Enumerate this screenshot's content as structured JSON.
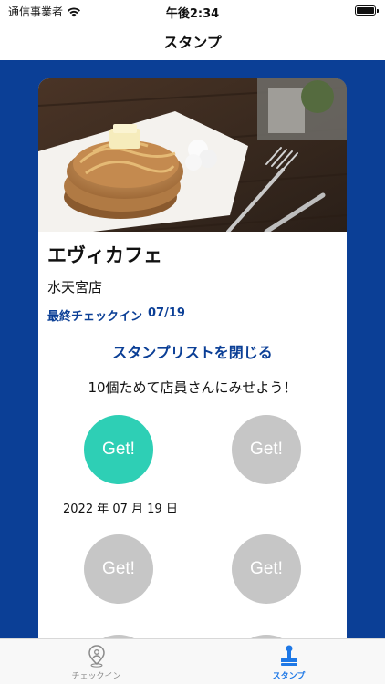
{
  "status_bar": {
    "carrier": "通信事業者",
    "time": "午後2:34"
  },
  "nav": {
    "title": "スタンプ"
  },
  "card": {
    "shop_name": "エヴィカフェ",
    "branch": "水天宮店",
    "last_checkin_label": "最終チェックイン",
    "last_checkin_date": "07/19",
    "close_list_label": "スタンプリストを閉じる",
    "hint": "10個ためて店員さんにみせよう！",
    "stamps": [
      {
        "label": "Get!",
        "state": "collected",
        "date": "2022 年 07 月 19 日"
      },
      {
        "label": "Get!",
        "state": "empty"
      },
      {
        "label": "Get!",
        "state": "empty"
      },
      {
        "label": "Get!",
        "state": "empty"
      }
    ]
  },
  "tabs": [
    {
      "label": "チェックイン",
      "icon": "map-pin-icon",
      "active": false
    },
    {
      "label": "スタンプ",
      "icon": "stamp-icon",
      "active": true
    }
  ],
  "colors": {
    "brand_blue": "#0b3f96",
    "stamp_collected": "#2ecfb5",
    "stamp_empty": "#c6c6c6",
    "tab_active": "#1e78e6"
  }
}
